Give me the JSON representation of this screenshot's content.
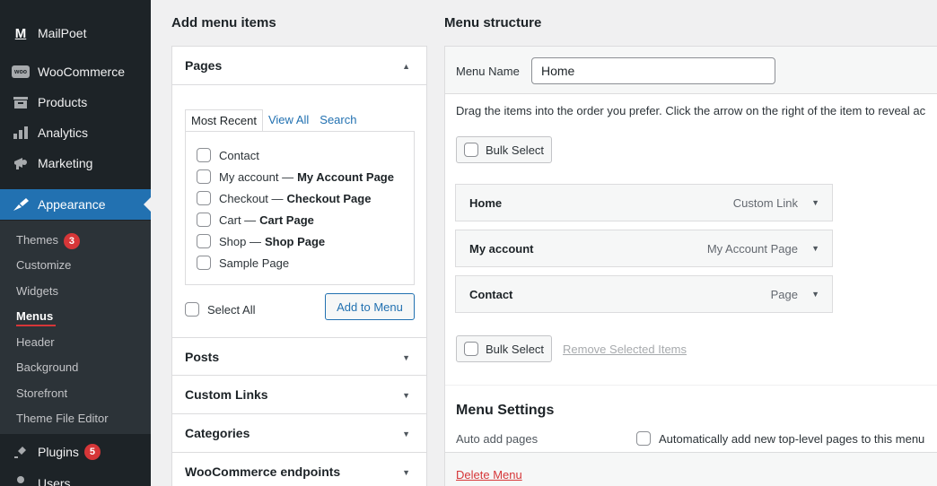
{
  "sidebar": {
    "items": [
      {
        "label": "MailPoet",
        "icon": "mailpoet-icon"
      },
      {
        "label": "WooCommerce",
        "icon": "woocommerce-icon",
        "icon_text": "woo"
      },
      {
        "label": "Products",
        "icon": "products-icon"
      },
      {
        "label": "Analytics",
        "icon": "analytics-icon"
      },
      {
        "label": "Marketing",
        "icon": "marketing-icon"
      },
      {
        "label": "Appearance",
        "icon": "appearance-icon"
      },
      {
        "label": "Plugins",
        "icon": "plugins-icon",
        "badge": "5"
      },
      {
        "label": "Users",
        "icon": "users-icon"
      }
    ],
    "appearance_sub": [
      {
        "label": "Themes",
        "badge": "3"
      },
      {
        "label": "Customize"
      },
      {
        "label": "Widgets"
      },
      {
        "label": "Menus"
      },
      {
        "label": "Header"
      },
      {
        "label": "Background"
      },
      {
        "label": "Storefront"
      },
      {
        "label": "Theme File Editor"
      }
    ],
    "mailpoet_mark": "M"
  },
  "left": {
    "title": "Add menu items",
    "pages_heading": "Pages",
    "tabs": [
      "Most Recent",
      "View All",
      "Search"
    ],
    "pages": [
      {
        "label": "Contact",
        "suffix": ""
      },
      {
        "label": "My account —",
        "suffix": "My Account Page"
      },
      {
        "label": "Checkout —",
        "suffix": "Checkout Page"
      },
      {
        "label": "Cart —",
        "suffix": "Cart Page"
      },
      {
        "label": "Shop —",
        "suffix": "Shop Page"
      },
      {
        "label": "Sample Page",
        "suffix": ""
      }
    ],
    "select_all": "Select All",
    "add_to_menu": "Add to Menu",
    "sections": [
      "Posts",
      "Custom Links",
      "Categories",
      "WooCommerce endpoints"
    ]
  },
  "right": {
    "title": "Menu structure",
    "menu_name_label": "Menu Name",
    "menu_name_value": "Home",
    "instructions": "Drag the items into the order you prefer. Click the arrow on the right of the item to reveal ac",
    "bulk_select": "Bulk Select",
    "menu_items": [
      {
        "title": "Home",
        "type": "Custom Link"
      },
      {
        "title": "My account",
        "type": "My Account Page"
      },
      {
        "title": "Contact",
        "type": "Page"
      }
    ],
    "remove_selected": "Remove Selected Items",
    "settings_title": "Menu Settings",
    "auto_add_label": "Auto add pages",
    "auto_add_option": "Automatically add new top-level pages to this menu",
    "delete_menu": "Delete Menu"
  },
  "colors": {
    "accent": "#2271b1",
    "sidebar_bg": "#1d2327",
    "badge": "#d63638",
    "delete": "#d63638"
  }
}
